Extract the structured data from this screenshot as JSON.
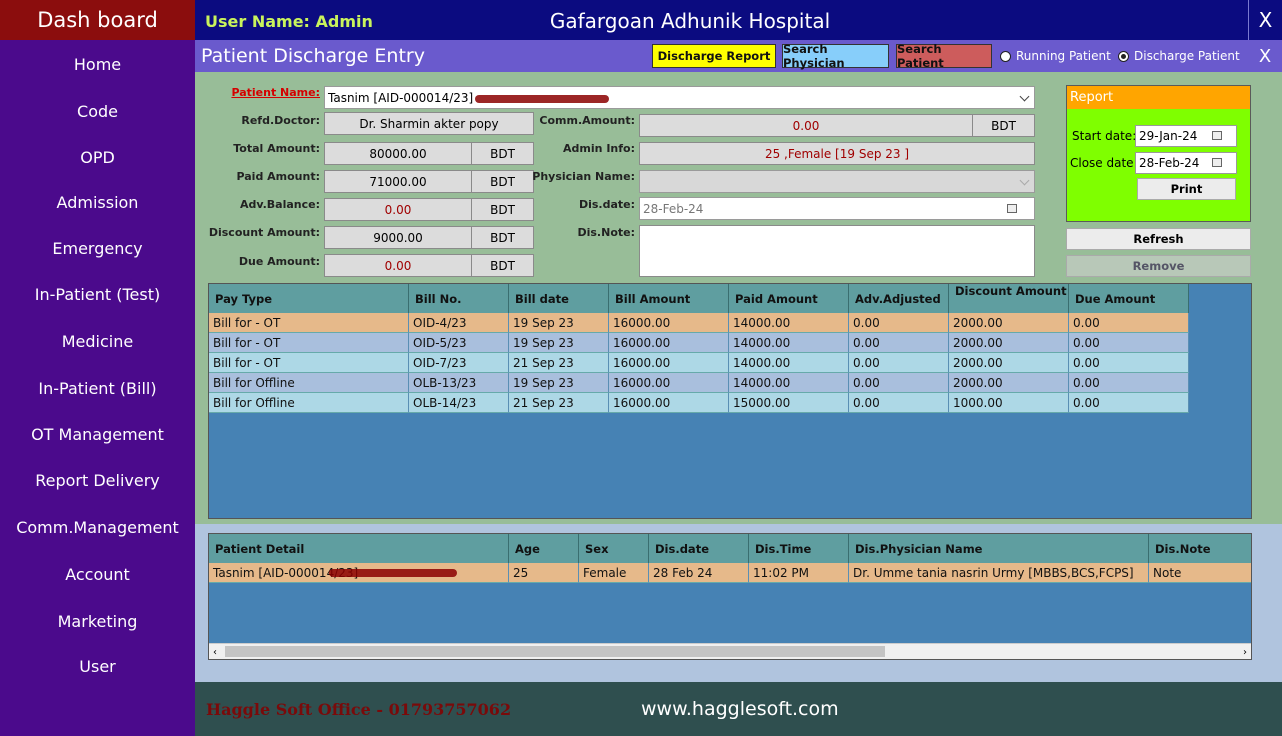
{
  "sidebar": {
    "header": "Dash board",
    "items": [
      "Home",
      "Code",
      "OPD",
      "Admission",
      "Emergency",
      "In-Patient (Test)",
      "Medicine",
      "In-Patient (Bill)",
      "OT Management",
      "Report Delivery",
      "Comm.Management",
      "Account",
      "Marketing",
      "User"
    ]
  },
  "topbar": {
    "user": "User Name: Admin",
    "hospital": "Gafargoan Adhunik Hospital",
    "close": "X"
  },
  "titlebar": {
    "title": "Patient Discharge Entry",
    "discharge_report": "Discharge Report",
    "search_physician": "Search Physician",
    "search_patient": "Search Patient",
    "radio_running": "Running Patient",
    "radio_discharge": "Discharge Patient",
    "close": "X"
  },
  "form": {
    "patient_name_label": "Patient Name:",
    "patient_name_value": "Tasnim [AID-000014/23]",
    "refd_doctor_label": "Refd.Doctor:",
    "refd_doctor_value": "Dr. Sharmin akter popy",
    "total_amount_label": "Total Amount:",
    "total_amount_value": "80000.00",
    "paid_amount_label": "Paid Amount:",
    "paid_amount_value": "71000.00",
    "adv_balance_label": "Adv.Balance:",
    "adv_balance_value": "0.00",
    "discount_amount_label": "Discount Amount:",
    "discount_amount_value": "9000.00",
    "due_amount_label": "Due Amount:",
    "due_amount_value": "0.00",
    "currency": "BDT",
    "comm_amount_label": "Comm.Amount:",
    "comm_amount_value": "0.00",
    "admin_info_label": "Admin Info:",
    "admin_info_value": "25 ,Female [19 Sep 23 ]",
    "physician_name_label": "Physician Name:",
    "dis_date_label": "Dis.date:",
    "dis_date_value": "28-Feb-24",
    "dis_note_label": "Dis.Note:"
  },
  "report": {
    "title": "Report",
    "start_label": "Start date:",
    "start_value": "29-Jan-24",
    "close_label": "Close date:",
    "close_value": "28-Feb-24",
    "print": "Print",
    "refresh": "Refresh",
    "remove": "Remove"
  },
  "bills": {
    "headers": [
      "Pay Type",
      "Bill No.",
      "Bill date",
      "Bill Amount",
      "Paid Amount",
      "Adv.Adjusted",
      "Discount Amount",
      "Due Amount"
    ],
    "rows": [
      [
        "Bill for - OT",
        "OID-4/23",
        "19 Sep 23",
        "16000.00",
        "14000.00",
        "0.00",
        "2000.00",
        "0.00"
      ],
      [
        "Bill for - OT",
        "OID-5/23",
        "19 Sep 23",
        "16000.00",
        "14000.00",
        "0.00",
        "2000.00",
        "0.00"
      ],
      [
        "Bill for - OT",
        "OID-7/23",
        "21 Sep 23",
        "16000.00",
        "14000.00",
        "0.00",
        "2000.00",
        "0.00"
      ],
      [
        "Bill for Offline",
        "OLB-13/23",
        "19 Sep 23",
        "16000.00",
        "14000.00",
        "0.00",
        "2000.00",
        "0.00"
      ],
      [
        "Bill for Offline",
        "OLB-14/23",
        "21 Sep 23",
        "16000.00",
        "15000.00",
        "0.00",
        "1000.00",
        "0.00"
      ]
    ]
  },
  "patients": {
    "headers": [
      "Patient Detail",
      "Age",
      "Sex",
      "Dis.date",
      "Dis.Time",
      "Dis.Physician Name",
      "Dis.Note"
    ],
    "rows": [
      [
        "Tasnim [AID-000014/23]",
        "25",
        "Female",
        "28 Feb 24",
        "11:02 PM",
        "Dr. Umme tania nasrin Urmy [MBBS,BCS,FCPS]",
        "Note"
      ]
    ]
  },
  "footer": {
    "office": "Haggle Soft Office - 01793757062",
    "website": "www.hagglesoft.com"
  },
  "colors": {
    "sidebar": "#4b0a8c",
    "topbar": "#0b0b80",
    "form_bg": "#98bd98",
    "grid_bg": "#4682b4",
    "selected_row": "#e6b98a"
  }
}
